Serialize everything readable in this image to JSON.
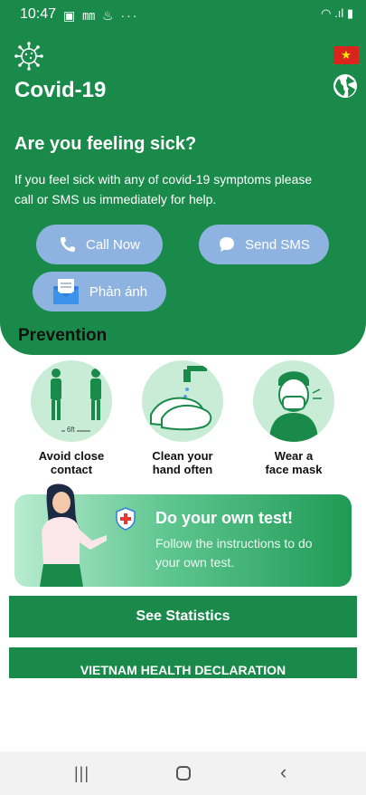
{
  "status_bar": {
    "time": "10:47",
    "left_icons": "▣ ㎜ ♨ ···",
    "right_icons": "◠ .ıl ▮"
  },
  "header": {
    "app_title": "Covid-19",
    "flag_icon": "vietnam-flag-icon",
    "flag_star": "★",
    "sick_title": "Are you feeling sick?",
    "sick_description": "If you feel sick with any of covid-19 symptoms please call or SMS us immediately for help."
  },
  "actions": {
    "call_label": "Call Now",
    "sms_label": "Send SMS",
    "feedback_label": "Phản ánh"
  },
  "prevention": {
    "title": "Prevention",
    "distance_tag": "6ft",
    "items": [
      {
        "label": "Avoid close\ncontact",
        "icon": "social-distance-icon"
      },
      {
        "label": "Clean your\nhand often",
        "icon": "hand-wash-icon"
      },
      {
        "label": "Wear a\nface mask",
        "icon": "face-mask-icon"
      }
    ]
  },
  "self_test": {
    "title": "Do your own test!",
    "description": "Follow the instructions to do your own test."
  },
  "buttons": {
    "statistics": "See Statistics",
    "declaration": "VIETNAM HEALTH DECLARATION"
  },
  "nav": {
    "recent": "|||",
    "back": "‹"
  },
  "colors": {
    "primary": "#1a8a4a",
    "pill": "#8eb3e0",
    "circle": "#c9ecd6"
  }
}
